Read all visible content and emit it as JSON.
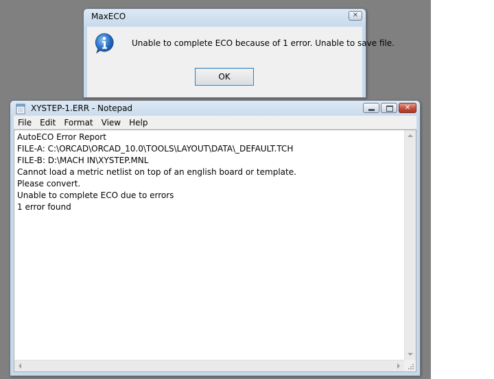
{
  "dialog": {
    "title": "MaxECO",
    "close_glyph": "✕",
    "icon": "info-icon",
    "message": "Unable to complete ECO because of 1 error.  Unable to save file.",
    "ok_label": "OK"
  },
  "notepad": {
    "title": "XYSTEP-1.ERR - Notepad",
    "close_glyph": "✕",
    "menu": [
      "File",
      "Edit",
      "Format",
      "View",
      "Help"
    ],
    "lines": [
      "AutoECO Error Report",
      "FILE-A: C:\\ORCAD\\ORCAD_10.0\\TOOLS\\LAYOUT\\DATA\\_DEFAULT.TCH",
      "FILE-B: D:\\MACH IN\\XYSTEP.MNL",
      "Cannot load a metric netlist on top of an english board or template.",
      "Please convert.",
      "Unable to complete ECO due to errors",
      "1 error found"
    ]
  },
  "colors": {
    "desktop": "#808080",
    "close_button": "#c24f3b",
    "ok_focus_border": "#3c7fb1"
  }
}
